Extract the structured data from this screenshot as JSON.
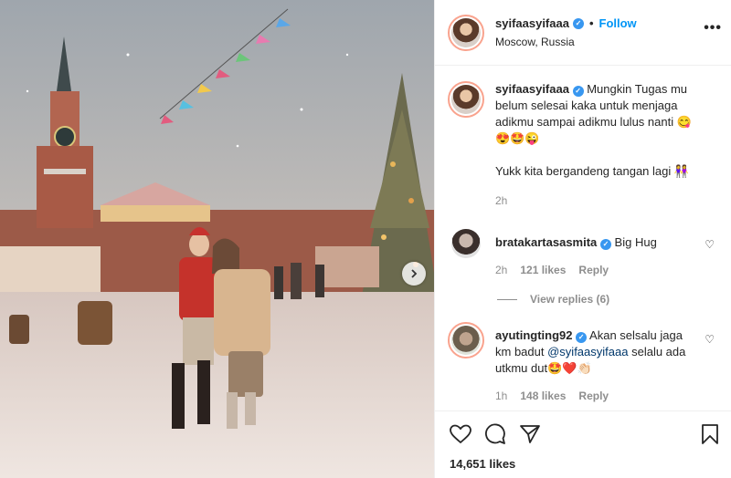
{
  "post": {
    "author": "syifaasyifaaa",
    "follow_label": "Follow",
    "location": "Moscow, Russia",
    "more_label": "•••",
    "dot": "•"
  },
  "caption": {
    "username": "syifaasyifaaa",
    "text_line1": "Mungkin Tugas mu belum selesai kaka untuk menjaga adikmu sampai adikmu lulus nanti 😋",
    "text_line2": "😍🤩😜",
    "text_line3": "Yukk kita bergandeng tangan lagi 👭",
    "time": "2h"
  },
  "comments": [
    {
      "username": "bratakartasasmita",
      "text": "Big Hug",
      "time": "2h",
      "likes": "121 likes",
      "reply_label": "Reply",
      "view_replies": "View replies (6)"
    },
    {
      "username": "ayutingting92",
      "text_before": "Akan selsalu jaga km badut",
      "mention": "@syifaasyifaaa",
      "text_after": "selalu ada utkmu dut🤩❤️👏🏻",
      "time": "1h",
      "likes": "148 likes",
      "reply_label": "Reply"
    }
  ],
  "footer": {
    "likes": "14,651 likes"
  },
  "icons": {
    "verified": "verified-badge-icon",
    "heart": "heart-icon",
    "comment": "comment-icon",
    "share": "share-icon",
    "bookmark": "bookmark-icon",
    "next": "chevron-right-icon",
    "more": "more-options-icon"
  },
  "colors": {
    "link_blue": "#0095f6",
    "verified_blue": "#3897f0",
    "muted": "#8e8e8e",
    "text": "#262626"
  }
}
